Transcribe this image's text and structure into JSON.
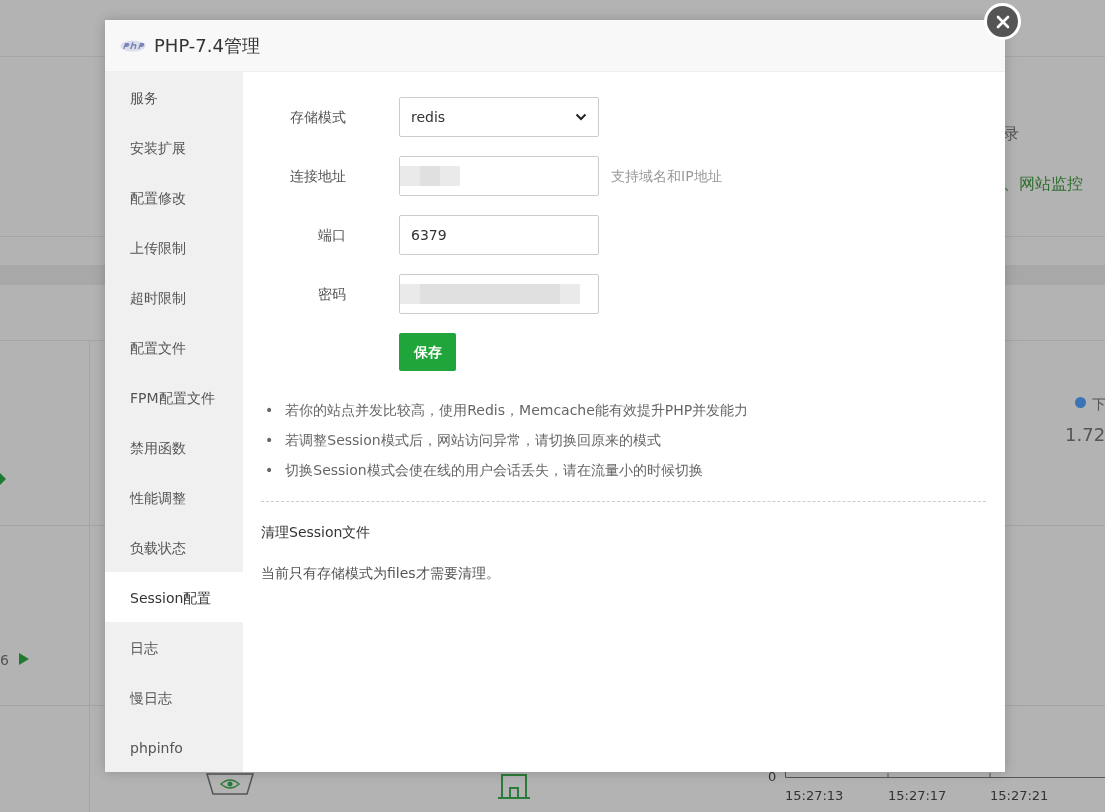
{
  "background": {
    "texts": [
      {
        "kind": "plain",
        "text": "录"
      },
      {
        "kind": "link",
        "text": "、网站监控"
      },
      {
        "kind": "legend",
        "text": "下"
      },
      {
        "kind": "value",
        "text": "1.72"
      },
      {
        "kind": "count",
        "text": "6"
      },
      {
        "kind": "axis",
        "text": "0"
      },
      {
        "kind": "time",
        "text": "15:27:13"
      },
      {
        "kind": "time",
        "text": "15:27:17"
      },
      {
        "kind": "time",
        "text": "15:27:21"
      }
    ]
  },
  "dialog": {
    "title": "PHP-7.4管理",
    "sidebar": {
      "items": [
        {
          "label": "服务",
          "selected": false
        },
        {
          "label": "安装扩展",
          "selected": false
        },
        {
          "label": "配置修改",
          "selected": false
        },
        {
          "label": "上传限制",
          "selected": false
        },
        {
          "label": "超时限制",
          "selected": false
        },
        {
          "label": "配置文件",
          "selected": false
        },
        {
          "label": "FPM配置文件",
          "selected": false
        },
        {
          "label": "禁用函数",
          "selected": false
        },
        {
          "label": "性能调整",
          "selected": false
        },
        {
          "label": "负载状态",
          "selected": false
        },
        {
          "label": "Session配置",
          "selected": true
        },
        {
          "label": "日志",
          "selected": false
        },
        {
          "label": "慢日志",
          "selected": false
        },
        {
          "label": "phpinfo",
          "selected": false
        }
      ]
    },
    "form": {
      "fields": [
        {
          "kind": "select",
          "label": "存储模式",
          "value": "redis"
        },
        {
          "kind": "blurred",
          "label": "连接地址",
          "hint": "支持域名和IP地址"
        },
        {
          "kind": "text",
          "label": "端口",
          "value": "6379"
        },
        {
          "kind": "blurred",
          "label": "密码"
        }
      ],
      "save_button": "保存"
    },
    "tips": [
      {
        "bullet": "•",
        "text": "若你的站点并发比较高，使用Redis，Memcache能有效提升PHP并发能力"
      },
      {
        "bullet": "•",
        "text": "若调整Session模式后，网站访问异常，请切换回原来的模式"
      },
      {
        "bullet": "•",
        "text": "切换Session模式会使在线的用户会话丢失，请在流量小的时候切换"
      }
    ],
    "clean_title": "清理Session文件",
    "clean_note": "当前只有存储模式为files才需要清理。"
  }
}
